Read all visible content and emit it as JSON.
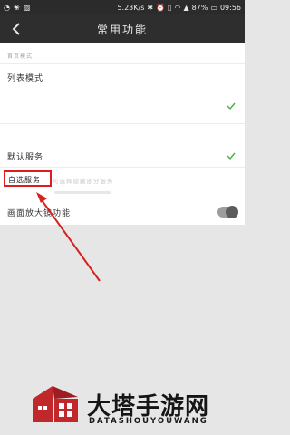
{
  "status_bar": {
    "network_speed": "5.23K/s",
    "battery": "87%",
    "time": "09:56",
    "icons": [
      "weibo-icon",
      "paw-icon",
      "image-icon",
      "bluetooth-icon",
      "alarm-icon",
      "vibrate-icon",
      "wifi-icon",
      "signal-icon",
      "battery-icon"
    ]
  },
  "header": {
    "title": "常用功能",
    "back_icon": "chevron-left-icon"
  },
  "settings": {
    "section_caption": "首页模式",
    "list_mode_label": "列表模式",
    "default_service_label": "默认服务",
    "custom_service_label": "自选服务",
    "custom_service_hint": "可选择隐藏部分服务",
    "zoom_label": "画面放大镜功能",
    "zoom_enabled": false
  },
  "annotation": {
    "highlight_color": "#d7201f"
  },
  "watermark": {
    "brand": "大塔手游网",
    "brand_pinyin": "DATASHOUYOUWANG",
    "logo_color": "#c0282c"
  }
}
